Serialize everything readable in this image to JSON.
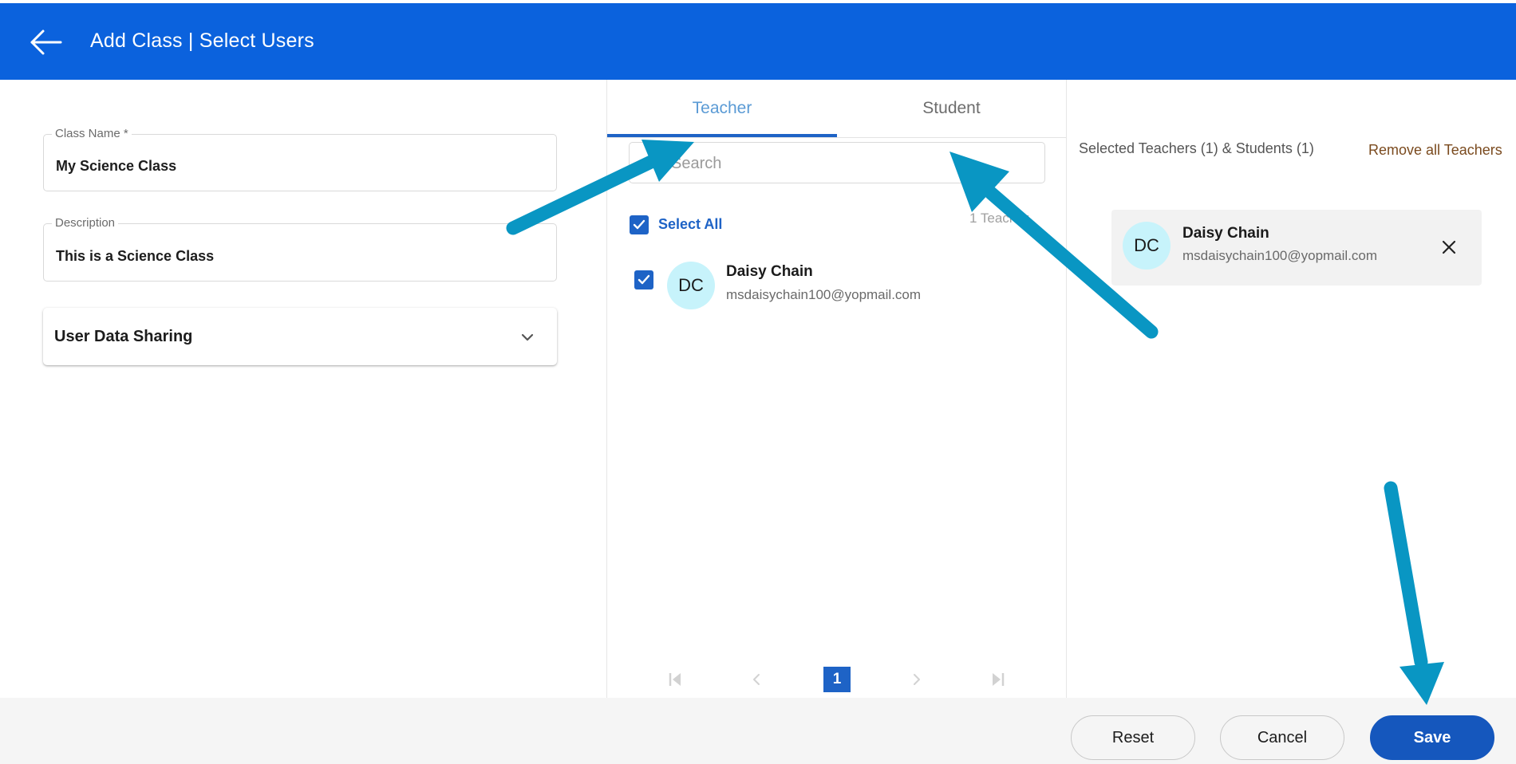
{
  "header": {
    "title": "Add Class | Select Users",
    "background_color": "#0b62dd"
  },
  "form": {
    "class_name": {
      "label": "Class Name *",
      "value": "My Science Class"
    },
    "description": {
      "label": "Description",
      "value": "This is a Science Class"
    },
    "user_data_sharing": {
      "label": "User Data Sharing"
    }
  },
  "tabs": [
    {
      "label": "Teacher",
      "active": true
    },
    {
      "label": "Student",
      "active": false
    }
  ],
  "search": {
    "placeholder": "Search"
  },
  "list": {
    "select_all_label": "Select All",
    "select_all_checked": true,
    "count_label": "1 Teacher",
    "users": [
      {
        "initials": "DC",
        "name": "Daisy Chain",
        "email": "msdaisychain100@yopmail.com",
        "checked": true
      }
    ]
  },
  "pagination": {
    "current_page": "1"
  },
  "selected": {
    "summary": "Selected Teachers (1) & Students (1)",
    "remove_all_label": "Remove all Teachers",
    "users": [
      {
        "initials": "DC",
        "name": "Daisy Chain",
        "email": "msdaisychain100@yopmail.com"
      }
    ]
  },
  "footer": {
    "reset_label": "Reset",
    "cancel_label": "Cancel",
    "save_label": "Save"
  },
  "colors": {
    "primary": "#1e63c6",
    "avatar_bg": "#c7f3fb",
    "annotation_arrow": "#0996c3"
  },
  "icons": [
    "back-arrow-icon",
    "chevron-down-icon",
    "search-icon",
    "checkmark-icon",
    "first-page-icon",
    "prev-page-icon",
    "next-page-icon",
    "last-page-icon",
    "close-icon"
  ]
}
